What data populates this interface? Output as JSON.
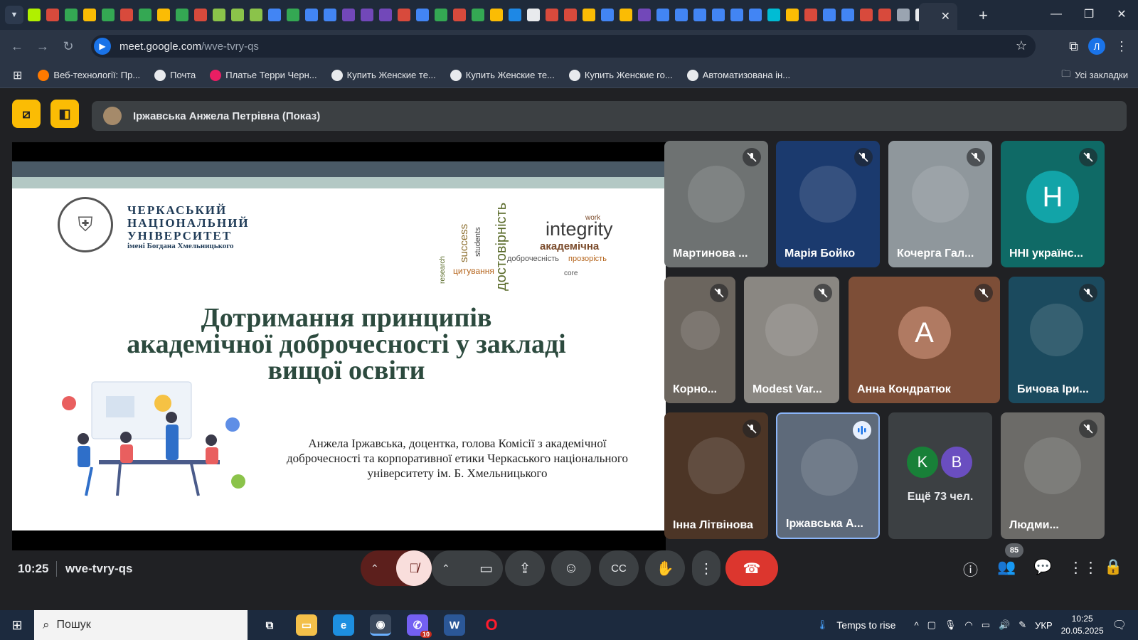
{
  "browser": {
    "address_host": "meet.google.com",
    "address_path": "/wve-tvry-qs",
    "profile_initial": "Л",
    "favicons": [
      "#b0f000",
      "#d84a3c",
      "#34a853",
      "#fbbc04",
      "#34a853",
      "#d84a3c",
      "#34a853",
      "#fbbc04",
      "#34a853",
      "#d84a3c",
      "#8bc34a",
      "#8bc34a",
      "#8bc34a",
      "#4285f4",
      "#34a853",
      "#4285f4",
      "#4285f4",
      "#7248b9",
      "#7248b9",
      "#7248b9",
      "#d84a3c",
      "#4285f4",
      "#34a853",
      "#d84a3c",
      "#34a853",
      "#fbbc04",
      "#1e88e5",
      "#e8eaed",
      "#d84a3c",
      "#d84a3c",
      "#fbbc04",
      "#4285f4",
      "#fbbc04",
      "#7248b9",
      "#4285f4",
      "#4285f4",
      "#4285f4",
      "#4285f4",
      "#4285f4",
      "#4285f4",
      "#00bcd4",
      "#fbbc04",
      "#d84a3c",
      "#4285f4",
      "#4285f4",
      "#d84a3c",
      "#d84a3c",
      "#9aa4b1",
      "#e8eaed"
    ],
    "bookmarks": [
      {
        "label": "Веб-технології: Пр...",
        "color": "#ff7a00"
      },
      {
        "label": "Почта",
        "color": "#e8eaed"
      },
      {
        "label": "Платье Терри Черн...",
        "color": "#e91e63"
      },
      {
        "label": "Купить Женские те...",
        "color": "#e8eaed"
      },
      {
        "label": "Купить Женские те...",
        "color": "#e8eaed"
      },
      {
        "label": "Купить Женские го...",
        "color": "#e8eaed"
      },
      {
        "label": "Автоматизована ін...",
        "color": "#e8eaed"
      }
    ],
    "all_bookmarks": "Усі закладки"
  },
  "meeting": {
    "presenter_banner": "Іржавська Анжела Петрівна (Показ)",
    "clock": "10:25",
    "meeting_code": "wve-tvry-qs",
    "participants_count": "85",
    "more_participants": "Ещё 73 чел.",
    "more_initials": [
      "K",
      "B"
    ]
  },
  "slide": {
    "university_name": "ЧЕРКАСЬКИЙ\nНАЦІОНАЛЬНИЙ\nУНІВЕРСИТЕТ",
    "university_sub": "імені Богдана Хмельницького",
    "cloud_words": [
      "integrity",
      "академічна",
      "доброчесність",
      "достовірність",
      "success",
      "students",
      "цитування",
      "прозорість",
      "research",
      "core",
      "work"
    ],
    "title": "Дотримання принципів академічної доброчесності у закладі вищої освіти",
    "author": "Анжела Іржавська, доцентка, голова Комісії з академічної доброчесності та корпоративної етики Черкаського національного університету ім. Б. Хмельницького"
  },
  "tiles": [
    {
      "name": "Мартинова ...",
      "bg": "#6e7272",
      "avatar": null,
      "muted": true
    },
    {
      "name": "Марія Бойко",
      "bg": "#1b3a6e",
      "avatar": null,
      "muted": true
    },
    {
      "name": "Кочерга Гал...",
      "bg": "#8f979c",
      "avatar": null,
      "muted": true
    },
    {
      "name": "ННІ українс...",
      "bg": "#0f6a66",
      "avatar": "Н",
      "muted": true
    },
    {
      "name": "Корно...",
      "bg": "#6b655e",
      "avatar": null,
      "muted": true
    },
    {
      "name": "Modest Var...",
      "bg": "#8a8782",
      "avatar": null,
      "muted": true
    },
    {
      "name": "Анна Кондратюк",
      "bg": "#7d4e37",
      "avatar": "А",
      "muted": true
    },
    {
      "name": "Бичова Іри...",
      "bg": "#1b4a5e",
      "avatar": null,
      "muted": true
    },
    {
      "name": "Інна Літвінова",
      "bg": "#4c3526",
      "avatar": null,
      "muted": true
    },
    {
      "name": "Іржавська А...",
      "bg": "#5e6a7a",
      "avatar": null,
      "muted": false
    },
    {
      "name": "Людми...",
      "bg": "#6c6b68",
      "avatar": null,
      "muted": true
    }
  ],
  "taskbar": {
    "search_placeholder": "Пошук",
    "weather": "Temps to rise",
    "lang": "УКР",
    "time": "10:25",
    "date": "20.05.2025",
    "viber_badge": "10"
  }
}
